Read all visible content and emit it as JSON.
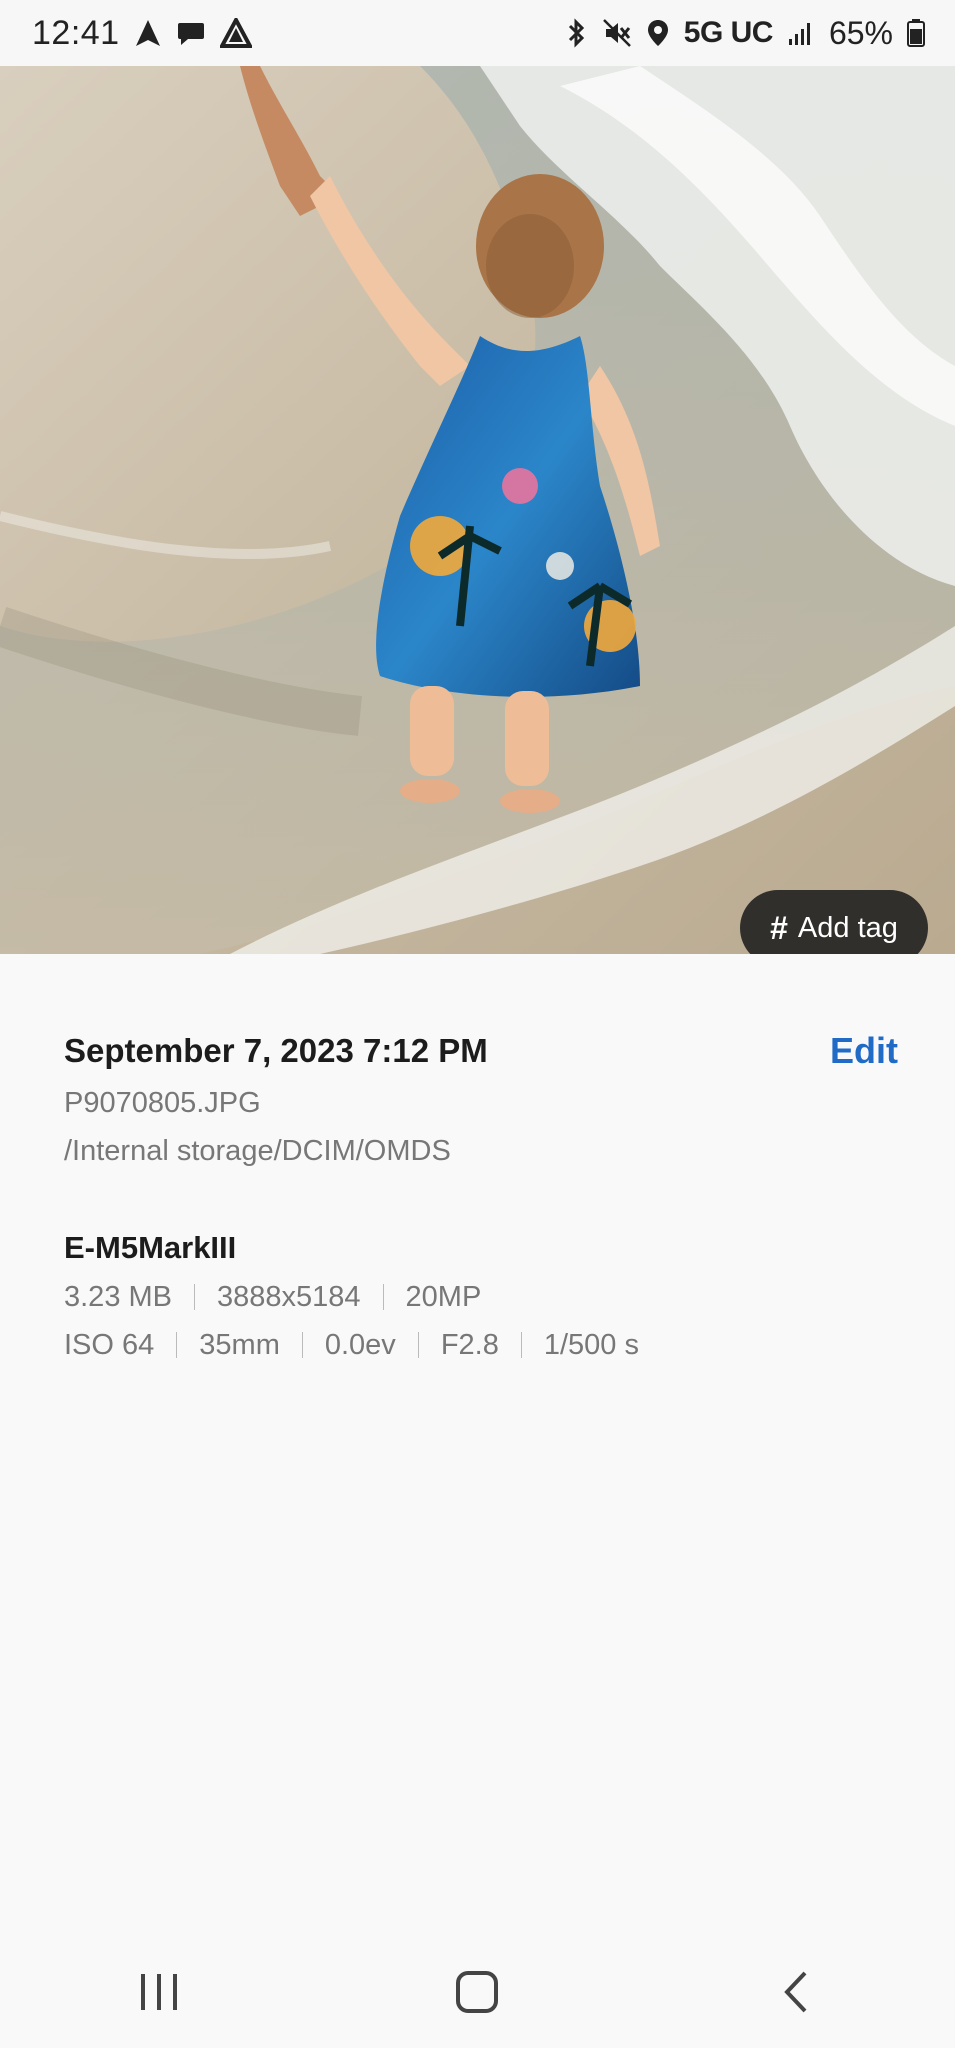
{
  "status_bar": {
    "time": "12:41",
    "left_icons": [
      "navigation-icon",
      "chat-icon",
      "alert-triangle-icon"
    ],
    "right_icons": [
      "bluetooth-icon",
      "mute-icon",
      "location-icon",
      "signal-icon",
      "battery-icon"
    ],
    "network": "5G UC",
    "battery": "65%"
  },
  "photo": {
    "description_icon": "photo",
    "add_tag_label": "Add tag"
  },
  "details": {
    "date": "September 7, 2023 7:12 PM",
    "edit_label": "Edit",
    "filename": "P9070805.JPG",
    "path": "/Internal storage/DCIM/OMDS",
    "camera": "E-M5MarkIII",
    "file_specs": [
      "3.23 MB",
      "3888x5184",
      "20MP"
    ],
    "exposure_specs": [
      "ISO 64",
      "35mm",
      "0.0ev",
      "F2.8",
      "1/500 s"
    ]
  },
  "nav_bar": {
    "buttons": [
      "recent-apps-icon",
      "home-icon",
      "back-icon"
    ]
  },
  "colors": {
    "accent": "#1f6bc6",
    "background": "#f9f9f9",
    "secondary_text": "#777777"
  }
}
